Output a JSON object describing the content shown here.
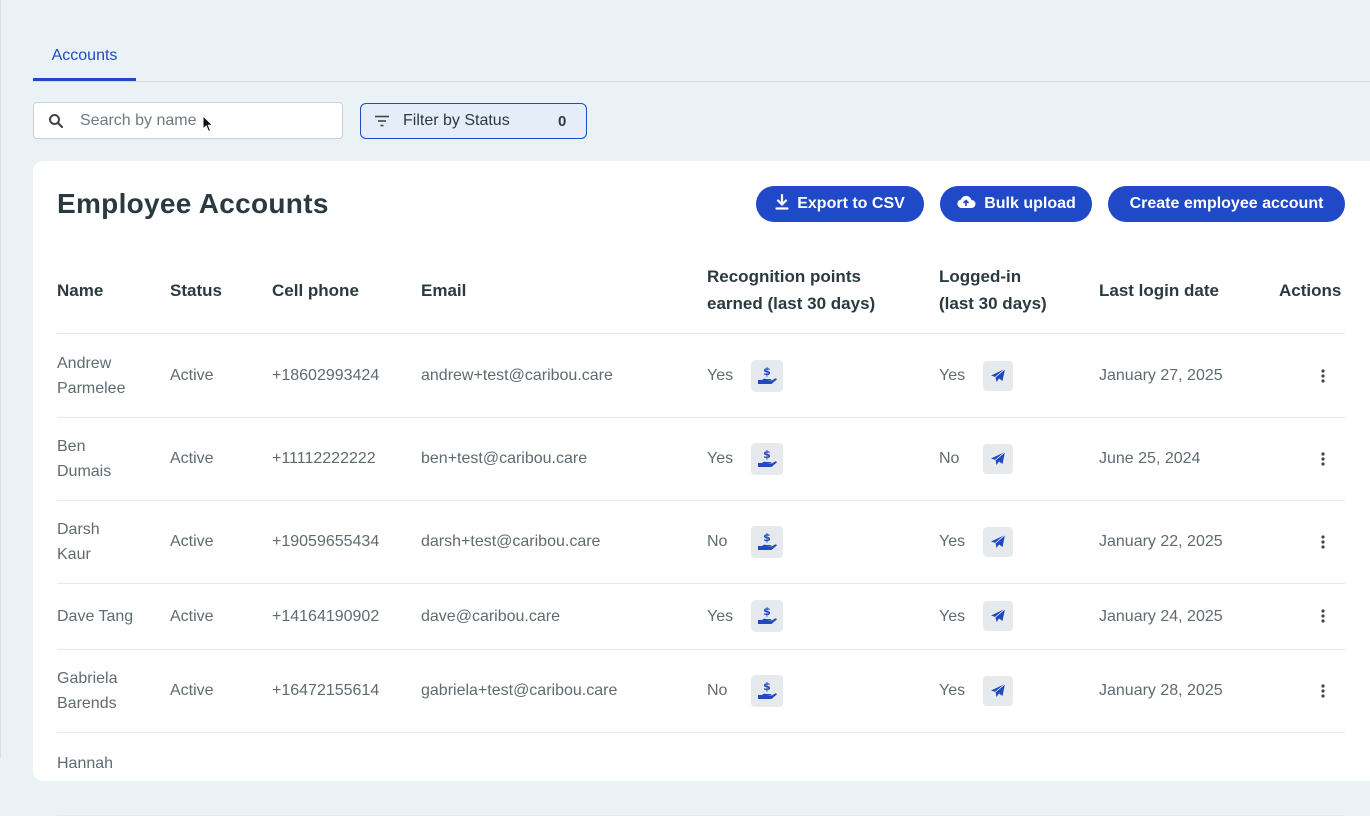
{
  "tabs": [
    {
      "label": "Accounts"
    }
  ],
  "search": {
    "placeholder": "Search by name"
  },
  "filter": {
    "label": "Filter by Status",
    "count": "0"
  },
  "card": {
    "title": "Employee Accounts",
    "buttons": {
      "export": "Export to CSV",
      "bulk": "Bulk upload",
      "create": "Create employee account"
    }
  },
  "table": {
    "headers": {
      "name": "Name",
      "status": "Status",
      "phone": "Cell phone",
      "email": "Email",
      "points_1": "Recognition points",
      "points_2": "earned (last 30 days)",
      "login_1": "Logged-in",
      "login_2": "(last 30 days)",
      "last_login": "Last login date",
      "actions": "Actions"
    },
    "rows": [
      {
        "name_1": "Andrew",
        "name_2": "Parmelee",
        "status": "Active",
        "phone": "+18602993424",
        "email": "andrew+test@caribou.care",
        "points": "Yes",
        "logged": "Yes",
        "last_login": "January 27, 2025"
      },
      {
        "name_1": "Ben",
        "name_2": "Dumais",
        "status": "Active",
        "phone": "+11112222222",
        "email": "ben+test@caribou.care",
        "points": "Yes",
        "logged": "No",
        "last_login": "June 25, 2024"
      },
      {
        "name_1": "Darsh",
        "name_2": "Kaur",
        "status": "Active",
        "phone": "+19059655434",
        "email": "darsh+test@caribou.care",
        "points": "No",
        "logged": "Yes",
        "last_login": "January 22, 2025"
      },
      {
        "name_1": "Dave Tang",
        "name_2": "",
        "status": "Active",
        "phone": "+14164190902",
        "email": "dave@caribou.care",
        "points": "Yes",
        "logged": "Yes",
        "last_login": "January 24, 2025"
      },
      {
        "name_1": "Gabriela",
        "name_2": "Barends",
        "status": "Active",
        "phone": "+16472155614",
        "email": "gabriela+test@caribou.care",
        "points": "No",
        "logged": "Yes",
        "last_login": "January 28, 2025"
      },
      {
        "name_1": "Hannah",
        "name_2": "",
        "status": "",
        "phone": "",
        "email": "",
        "points": "",
        "logged": "",
        "last_login": ""
      }
    ]
  },
  "colors": {
    "accent": "#1f49c6",
    "page_bg": "#eaf2f5",
    "card_bg": "#ffffff"
  },
  "icons": {
    "search": "search-icon",
    "filter": "filter-icon",
    "download": "download-icon",
    "upload": "cloud-upload-icon",
    "points": "hand-dollar-icon",
    "send": "paper-plane-icon",
    "actions": "more-vertical-icon"
  }
}
